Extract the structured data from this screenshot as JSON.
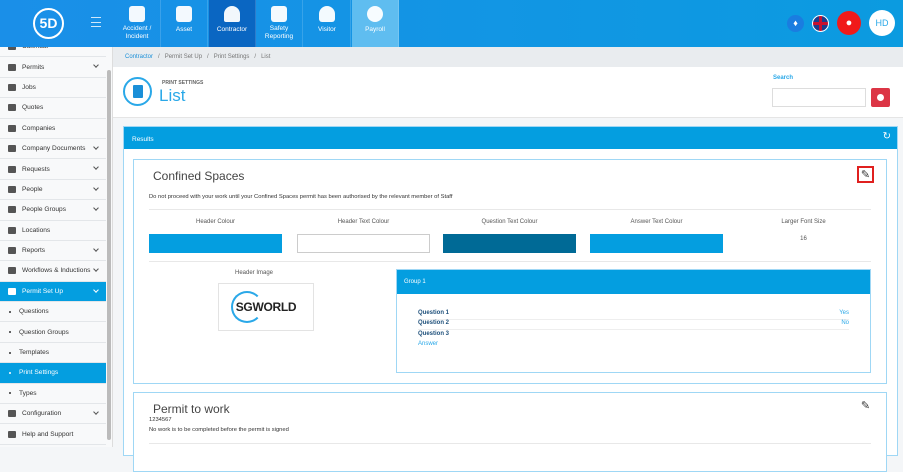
{
  "topbar": {
    "logo": "5D",
    "modules": [
      {
        "label": "Accident / Incident",
        "icon": "first-aid-icon"
      },
      {
        "label": "Asset",
        "icon": "boxes-icon"
      },
      {
        "label": "Contractor",
        "icon": "hard-hat-icon",
        "active": true
      },
      {
        "label": "Safety Reporting",
        "icon": "shield-file-icon"
      },
      {
        "label": "Visitor",
        "icon": "user-icon"
      },
      {
        "label": "Payroll",
        "icon": "coins-icon"
      }
    ],
    "avatar": "HD"
  },
  "sidebar": {
    "items": [
      {
        "label": "Calendar"
      },
      {
        "label": "Permits",
        "chev": true
      },
      {
        "label": "Jobs"
      },
      {
        "label": "Quotes"
      },
      {
        "label": "Companies"
      },
      {
        "label": "Company Documents",
        "chev": true
      },
      {
        "label": "Requests",
        "chev": true
      },
      {
        "label": "People",
        "chev": true
      },
      {
        "label": "People Groups",
        "chev": true
      },
      {
        "label": "Locations"
      },
      {
        "label": "Reports",
        "chev": true
      },
      {
        "label": "Workflows & Inductions",
        "chev": true
      },
      {
        "label": "Permit Set Up",
        "chev": true,
        "active": true
      },
      {
        "label": "Questions",
        "sub": true
      },
      {
        "label": "Question Groups",
        "sub": true
      },
      {
        "label": "Templates",
        "sub": true
      },
      {
        "label": "Print Settings",
        "sub": true,
        "active": true
      },
      {
        "label": "Types",
        "sub": true
      },
      {
        "label": "Configuration",
        "chev": true
      },
      {
        "label": "Help and Support"
      }
    ]
  },
  "breadcrumb": [
    "Contractor",
    "/",
    "Permit Set Up",
    "/",
    "Print Settings",
    "/",
    "List"
  ],
  "header": {
    "subtitle": "PRINT SETTINGS",
    "title": "List",
    "search_label": "Search",
    "search_value": ""
  },
  "results": {
    "title": "Results",
    "card1": {
      "title": "Confined Spaces",
      "desc": "Do not proceed with your work until your Confined Spaces permit has been authorised by the relevant member of Staff",
      "columns": [
        "Header Colour",
        "Header Text Colour",
        "Question Text Colour",
        "Answer Text Colour",
        "Larger Font Size"
      ],
      "colors": {
        "header": "#049ee0",
        "header_text": "#ffffff",
        "question_text": "#006a96",
        "answer_text": "#049ee0"
      },
      "font_size": "16",
      "header_image_label": "Header Image",
      "logo_text": "SGWORLD",
      "group": {
        "title": "Group 1",
        "questions": [
          {
            "q": "Question 1",
            "a": "Yes"
          },
          {
            "q": "Question 2",
            "a": "No"
          },
          {
            "q": "Question 3",
            "a": ""
          }
        ],
        "answer_label": "Answer"
      }
    },
    "card2": {
      "title": "Permit to work",
      "code": "1234567",
      "desc": "No work is to be completed before the permit is signed"
    }
  }
}
